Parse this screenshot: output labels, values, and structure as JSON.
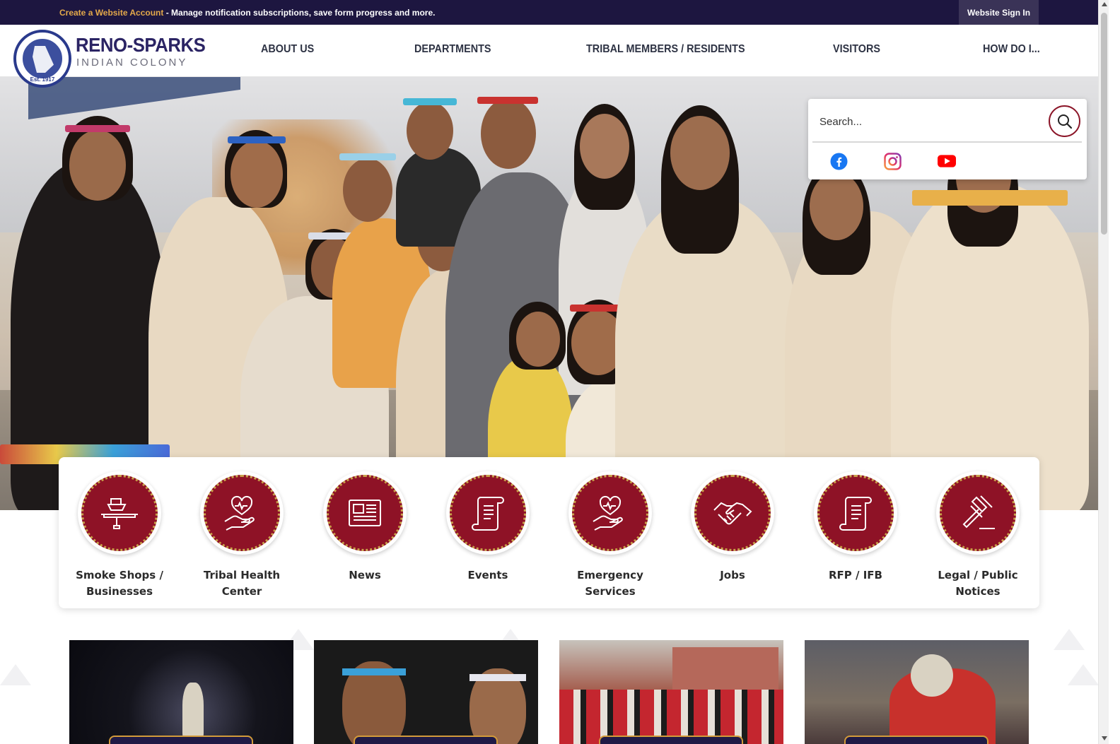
{
  "topbar": {
    "create_link": "Create a Website Account",
    "create_text": " - Manage notification subscriptions, save form progress and more.",
    "signin_label": "Website Sign In"
  },
  "logo": {
    "title": "RENO-SPARKS",
    "subtitle": "INDIAN COLONY",
    "seal_ring_text": "Reno-Sparks Indian Colony",
    "seal_est": "Est. 1917"
  },
  "nav": {
    "items": [
      {
        "label": "ABOUT US"
      },
      {
        "label": "DEPARTMENTS"
      },
      {
        "label": "TRIBAL MEMBERS / RESIDENTS"
      },
      {
        "label": "VISITORS"
      },
      {
        "label": "HOW DO I..."
      }
    ]
  },
  "search": {
    "placeholder": "Search..."
  },
  "social": {
    "facebook": "facebook-icon",
    "instagram": "instagram-icon",
    "youtube": "youtube-icon"
  },
  "quick_links": [
    {
      "label": "Smoke Shops / Businesses",
      "icon": "pipe-icon"
    },
    {
      "label": "Tribal Health Center",
      "icon": "heart-hand-icon"
    },
    {
      "label": "News",
      "icon": "newspaper-icon"
    },
    {
      "label": "Events",
      "icon": "scroll-icon"
    },
    {
      "label": "Emergency Services",
      "icon": "heart-hand-icon"
    },
    {
      "label": "Jobs",
      "icon": "handshake-icon"
    },
    {
      "label": "RFP / IFB",
      "icon": "scroll-icon"
    },
    {
      "label": "Legal / Public Notices",
      "icon": "gavel-icon"
    }
  ],
  "colors": {
    "topbar": "#1d1640",
    "accent_red": "#8e1226",
    "gold": "#c9a14a",
    "link_gold": "#e3a84a",
    "navy": "#2b2464"
  }
}
